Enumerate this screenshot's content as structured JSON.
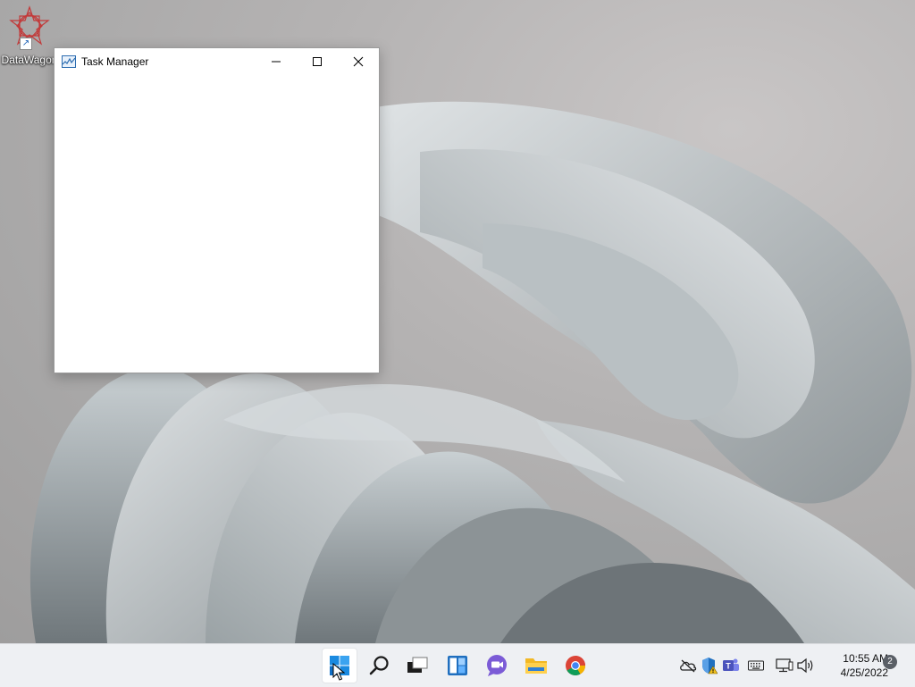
{
  "desktop": {
    "icons": [
      {
        "label": "DataWagon",
        "icon": "datawagon-logo-icon"
      }
    ]
  },
  "window": {
    "title": "Task Manager",
    "app_icon": "task-manager-icon",
    "controls": {
      "minimize": "minimize-icon",
      "maximize": "maximize-icon",
      "close": "close-icon"
    }
  },
  "taskbar": {
    "apps": [
      {
        "name": "Start",
        "icon": "windows-start-icon",
        "active": true
      },
      {
        "name": "Search",
        "icon": "search-icon"
      },
      {
        "name": "Task View",
        "icon": "task-view-icon"
      },
      {
        "name": "Widgets",
        "icon": "widgets-icon"
      },
      {
        "name": "Chat",
        "icon": "teams-chat-icon"
      },
      {
        "name": "File Explorer",
        "icon": "folder-icon"
      },
      {
        "name": "Google Chrome",
        "icon": "chrome-icon"
      }
    ],
    "tray": [
      {
        "icon": "onedrive-offline-icon"
      },
      {
        "icon": "security-warning-icon"
      },
      {
        "icon": "teams-icon"
      },
      {
        "icon": "keyboard-icon"
      },
      {
        "icon": "network-icon"
      },
      {
        "icon": "volume-icon"
      }
    ],
    "clock": {
      "time": "10:55 AM",
      "date": "4/25/2022"
    },
    "notification_count": "2"
  },
  "colors": {
    "taskbar_bg": "#eef0f3",
    "window_bg": "#ffffff",
    "accent": "#0067c0"
  }
}
